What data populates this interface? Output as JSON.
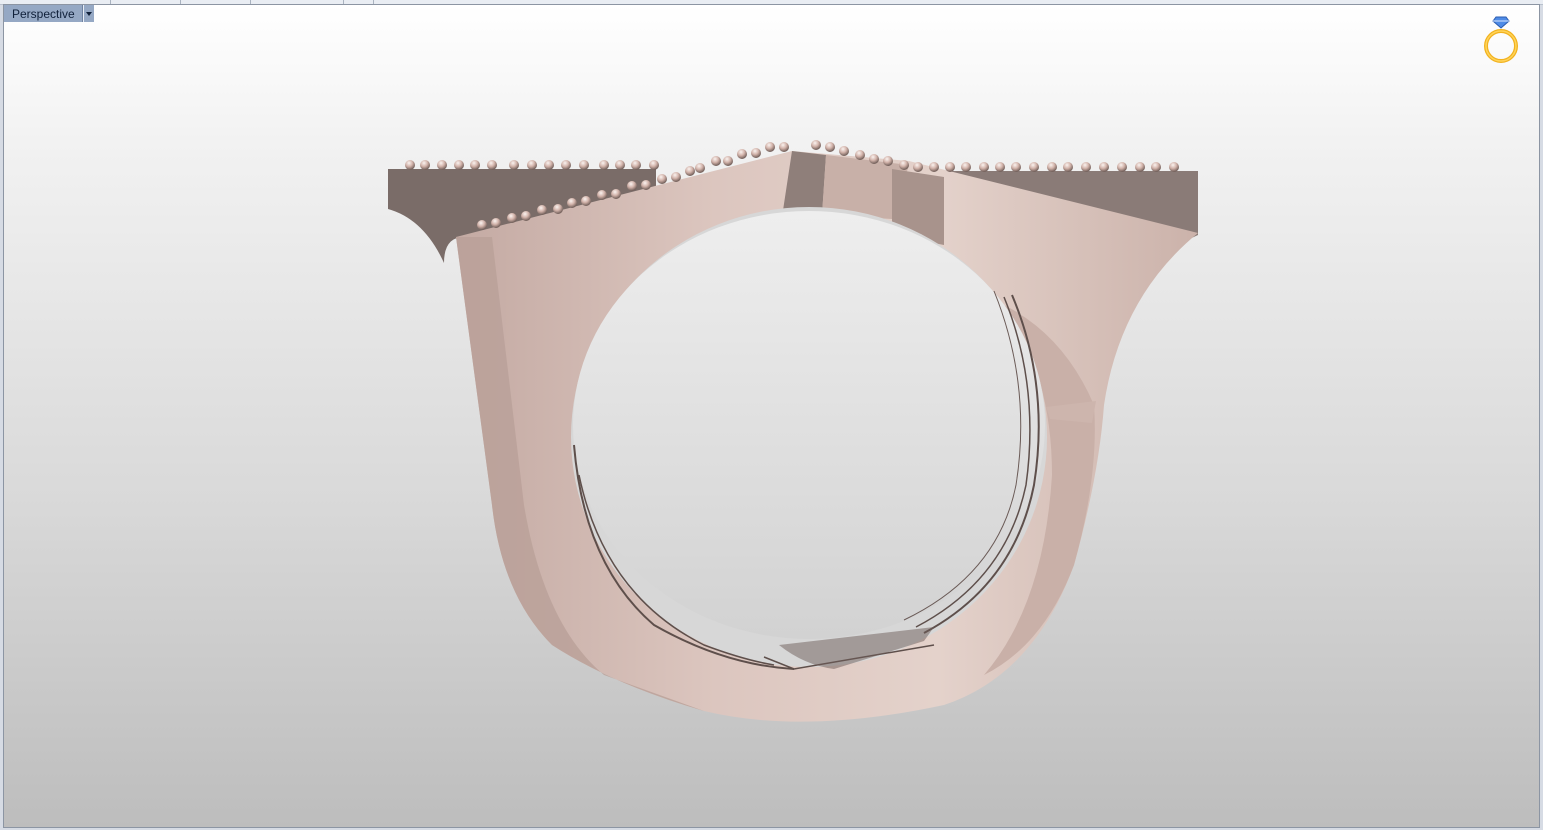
{
  "viewport": {
    "title": "Perspective",
    "menu_icon": "dropdown-arrow-icon",
    "render_mode_icon": "ring-diamond-icon"
  },
  "scene": {
    "object": "ring-model",
    "metal_color": "#d7bfb6",
    "shadow_color": "#8c7d79"
  }
}
